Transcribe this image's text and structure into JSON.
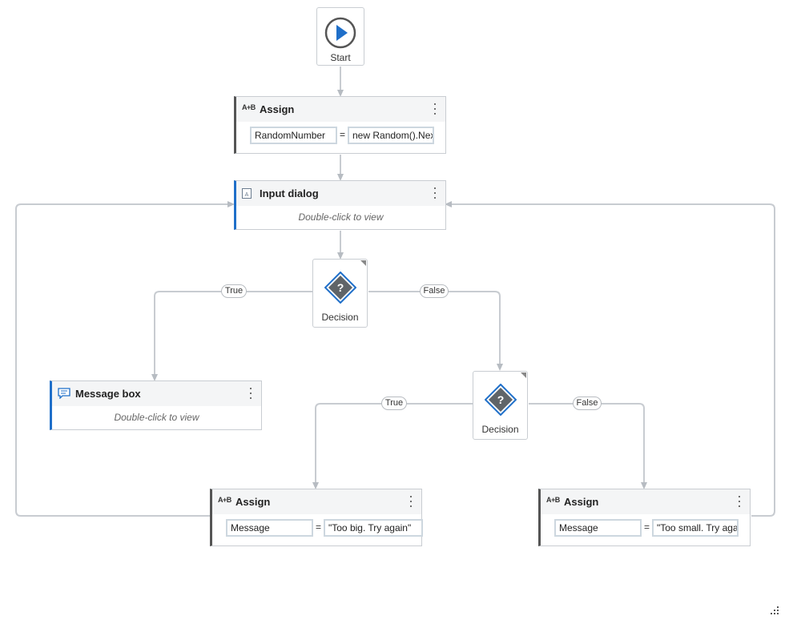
{
  "colors": {
    "connector": "#c3c8ce",
    "accent": "#1f6fc9",
    "decision_icon": "#5f6468"
  },
  "start": {
    "label": "Start",
    "icon": "play-icon"
  },
  "assign1": {
    "icon_text": "A+B",
    "title": "Assign",
    "to": "RandomNumber",
    "value": "new Random().Next"
  },
  "input_dialog": {
    "title": "Input dialog",
    "hint": "Double-click to view",
    "icon": "input-dialog-icon"
  },
  "decision1": {
    "label": "Decision",
    "true_label": "True",
    "false_label": "False",
    "icon": "decision-icon"
  },
  "message_box": {
    "title": "Message box",
    "hint": "Double-click to view",
    "icon": "message-box-icon"
  },
  "decision2": {
    "label": "Decision",
    "true_label": "True",
    "false_label": "False",
    "icon": "decision-icon"
  },
  "assign_big": {
    "icon_text": "A+B",
    "title": "Assign",
    "to": "Message",
    "value": "\"Too big. Try again\""
  },
  "assign_small": {
    "icon_text": "A+B",
    "title": "Assign",
    "to": "Message",
    "value": "\"Too small. Try again\""
  },
  "operators": {
    "equals": "="
  },
  "resize_grip": {
    "icon": "resize-grip-icon"
  }
}
